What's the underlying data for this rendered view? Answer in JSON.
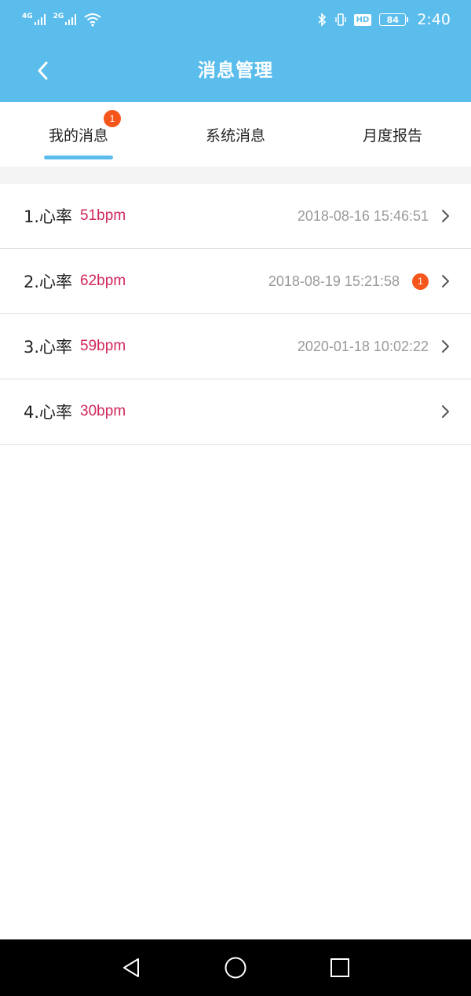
{
  "status_bar": {
    "network1": "4G",
    "network2": "2G",
    "hd": "HD",
    "battery": "84",
    "time": "2:40",
    "icons": [
      "signal-icon",
      "wifi-icon",
      "bluetooth-icon",
      "vibrate-icon",
      "battery-icon"
    ]
  },
  "header": {
    "title": "消息管理",
    "back_icon": "back-arrow-icon"
  },
  "tabs": [
    {
      "label": "我的消息",
      "badge": "1",
      "active": true
    },
    {
      "label": "系统消息"
    },
    {
      "label": "月度报告"
    }
  ],
  "messages": [
    {
      "title": "1.心率",
      "value": "51bpm",
      "time": "2018-08-16 15:46:51",
      "badge": ""
    },
    {
      "title": "2.心率",
      "value": "62bpm",
      "time": "2018-08-19 15:21:58",
      "badge": "1"
    },
    {
      "title": "3.心率",
      "value": "59bpm",
      "time": "2020-01-18 10:02:22",
      "badge": ""
    },
    {
      "title": "4.心率",
      "value": "30bpm",
      "time": "",
      "badge": ""
    }
  ],
  "colors": {
    "accent": "#5bbdec",
    "badge": "#f4561c",
    "value": "#d1275a",
    "muted_text": "#9a9a9a"
  },
  "nav": [
    "back-triangle-icon",
    "home-circle-icon",
    "recents-square-icon"
  ]
}
